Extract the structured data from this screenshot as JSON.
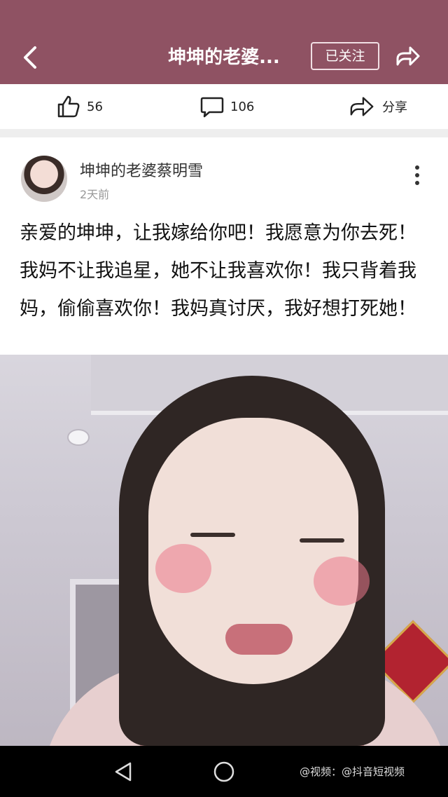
{
  "header": {
    "title": "坤坤的老婆...",
    "follow_label": "已关注"
  },
  "actions": {
    "like_count": "56",
    "comment_count": "106",
    "share_label": "分享"
  },
  "post": {
    "username": "坤坤的老婆蔡明雪",
    "time": "2天前",
    "body": "亲爱的坤坤，让我嫁给你吧！我愿意为你去死！我妈不让我追星，她不让我喜欢你！我只背着我妈，偷偷喜欢你！我妈真讨厌，我好想打死她！"
  },
  "watermark": "@视频：@抖音短视频"
}
